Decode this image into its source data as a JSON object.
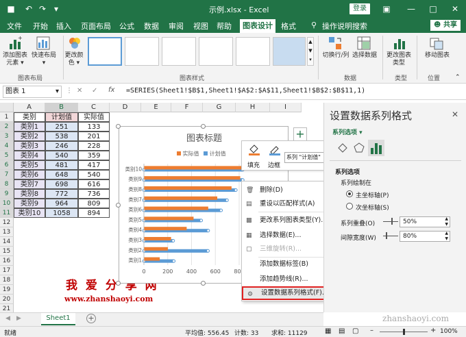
{
  "window": {
    "title": "示例.xlsx - Excel",
    "login": "登录"
  },
  "menu": {
    "items": [
      "文件",
      "开始",
      "插入",
      "页面布局",
      "公式",
      "数据",
      "审阅",
      "视图",
      "帮助",
      "图表设计",
      "格式"
    ],
    "active": "图表设计",
    "tell_me": "操作说明搜索",
    "share": "共享"
  },
  "ribbon": {
    "add_element": "添加图表元素 ▾",
    "quick_layout": "快速布局 ▾",
    "change_colors": "更改颜色 ▾",
    "group_layout": "图表布局",
    "group_styles": "图表样式",
    "switch_row_col": "切换行/列",
    "select_data": "选择数据",
    "group_data": "数据",
    "change_type": "更改图表类型",
    "group_type": "类型",
    "move_chart": "移动图表",
    "group_location": "位置"
  },
  "formula_bar": {
    "name_box": "图表 1",
    "fx": "fx",
    "formula": "=SERIES(Sheet1!$B$1,Sheet1!$A$2:$A$11,Sheet1!$B$2:$B$11,1)"
  },
  "sheet": {
    "columns": [
      "A",
      "B",
      "C",
      "D",
      "E",
      "F",
      "G",
      "H",
      "I"
    ],
    "rows": [
      "1",
      "2",
      "3",
      "4",
      "5",
      "6",
      "7",
      "8",
      "9",
      "10",
      "11",
      "12",
      "13",
      "14",
      "15",
      "16",
      "17",
      "18",
      "19",
      "20",
      "21"
    ],
    "table": {
      "headers": [
        "类别",
        "计划值",
        "实际值"
      ],
      "data": [
        [
          "类别1",
          "251",
          "133"
        ],
        [
          "类别2",
          "538",
          "201"
        ],
        [
          "类别3",
          "246",
          "228"
        ],
        [
          "类别4",
          "540",
          "359"
        ],
        [
          "类别5",
          "481",
          "417"
        ],
        [
          "类别6",
          "648",
          "540"
        ],
        [
          "类别7",
          "698",
          "616"
        ],
        [
          "类别8",
          "772",
          "736"
        ],
        [
          "类别9",
          "964",
          "809"
        ],
        [
          "类别10",
          "1058",
          "894"
        ]
      ]
    },
    "watermark_cn": "我 爱 分 享 网",
    "watermark_url": "www.zhanshaoyi.com",
    "tab": "Sheet1"
  },
  "chart_data": {
    "type": "bar",
    "title": "图表标题",
    "categories": [
      "类别1",
      "类别2",
      "类别3",
      "类别4",
      "类别5",
      "类别6",
      "类别7",
      "类别8",
      "类别9",
      "类别10"
    ],
    "series": [
      {
        "name": "实际值",
        "values": [
          133,
          201,
          228,
          359,
          417,
          540,
          616,
          736,
          809,
          894
        ],
        "color": "#ed7d31"
      },
      {
        "name": "计划值",
        "values": [
          251,
          538,
          246,
          540,
          481,
          648,
          698,
          772,
          964,
          1058
        ],
        "color": "#5b9bd5"
      }
    ],
    "xlim": [
      0,
      800
    ],
    "xticks": [
      "0",
      "200",
      "400",
      "600",
      "800"
    ],
    "legend": "top"
  },
  "mini_toolbar": {
    "fill": "填充",
    "outline": "边框",
    "series_select": "系列 \"计划值\""
  },
  "context_menu": [
    {
      "label": "删除(D)",
      "disabled": false
    },
    {
      "label": "重设以匹配样式(A)",
      "disabled": false
    },
    {
      "label": "更改系列图表类型(Y)...",
      "disabled": false
    },
    {
      "label": "选择数据(E)...",
      "disabled": false
    },
    {
      "label": "三维旋转(R)...",
      "disabled": true
    },
    {
      "label": "添加数据标签(B)",
      "disabled": false
    },
    {
      "label": "添加趋势线(R)...",
      "disabled": false
    },
    {
      "label": "设置数据系列格式(F)...",
      "disabled": false
    }
  ],
  "pane": {
    "title": "设置数据系列格式",
    "section": "系列选项 ▾",
    "group": "系列选项",
    "plot_on": "系列绘制在",
    "primary": "主坐标轴(P)",
    "secondary": "次坐标轴(S)",
    "overlap_label": "系列重叠(O)",
    "overlap_value": "50%",
    "gap_label": "间隙宽度(W)",
    "gap_value": "80%"
  },
  "status": {
    "ready": "就绪",
    "average": "平均值: 556.45",
    "count": "计数: 33",
    "sum": "求和: 11129",
    "zoom": "100%",
    "site": "zhanshaoyi.com"
  }
}
